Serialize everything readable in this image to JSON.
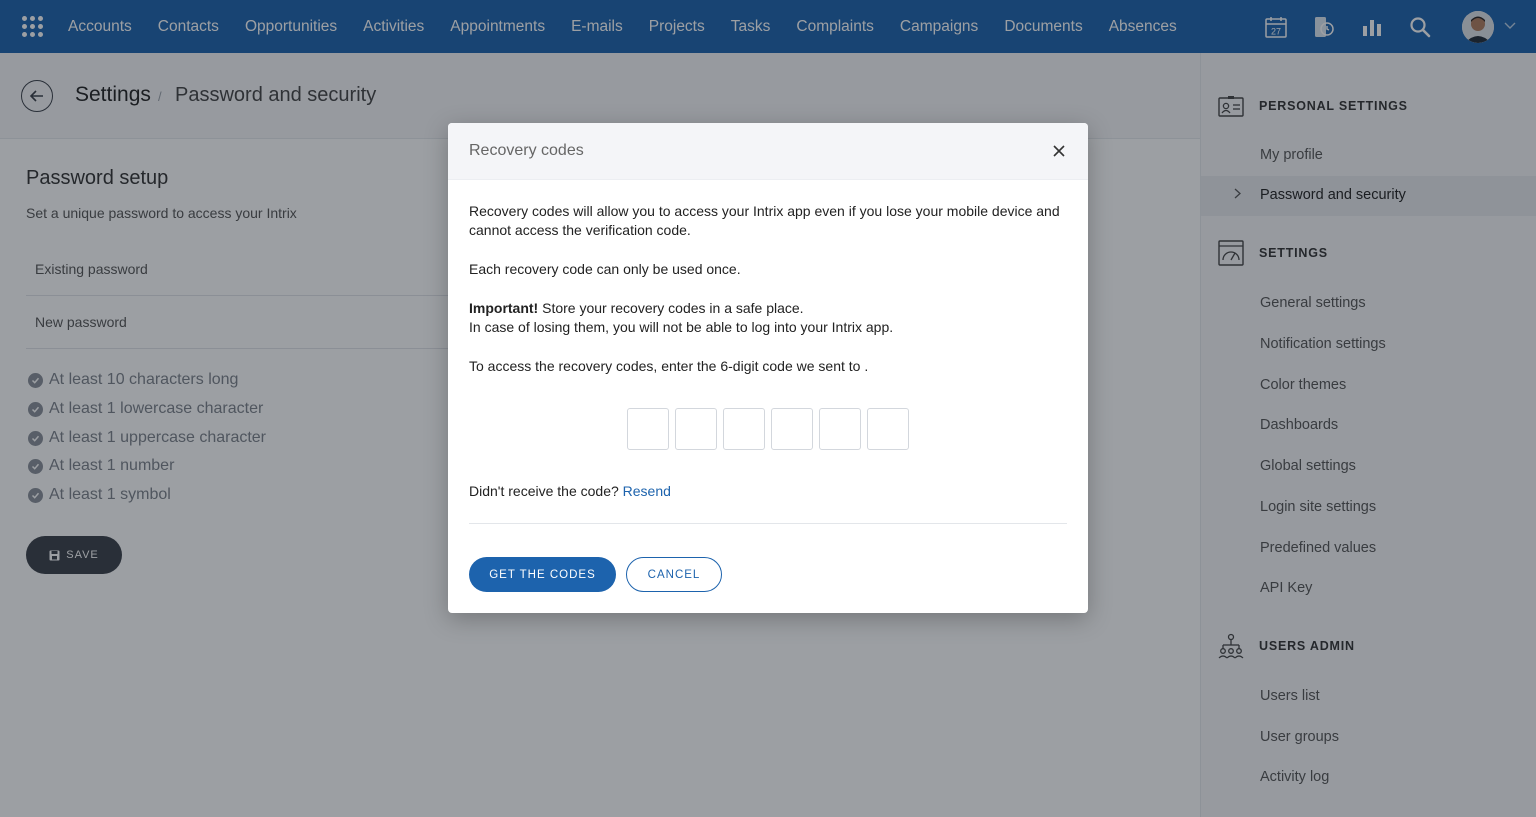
{
  "nav": {
    "items": [
      "Accounts",
      "Contacts",
      "Opportunities",
      "Activities",
      "Appointments",
      "E-mails",
      "Projects",
      "Tasks",
      "Complaints",
      "Campaigns",
      "Documents",
      "Absences"
    ],
    "calendar_day": "27",
    "icons": [
      "apps-grid-icon",
      "calendar-icon",
      "mobile-sync-icon",
      "bar-chart-icon",
      "search-icon",
      "avatar",
      "chevron-down-icon"
    ]
  },
  "breadcrumb": {
    "root": "Settings",
    "separator": "/",
    "current": "Password and security"
  },
  "password_setup": {
    "title": "Password setup",
    "subtitle": "Set a unique password to access your Intrix",
    "existing_label": "Existing password",
    "new_label": "New password",
    "rules": [
      "At least 10 characters long",
      "At least 1 lowercase character",
      "At least 1 uppercase character",
      "At least 1 number",
      "At least 1 symbol"
    ],
    "save_label": "SAVE"
  },
  "sidebar": {
    "personal": {
      "title": "PERSONAL SETTINGS",
      "items": [
        "My profile",
        "Password and security"
      ],
      "active": "Password and security"
    },
    "settings": {
      "title": "SETTINGS",
      "items": [
        "General settings",
        "Notification settings",
        "Color themes",
        "Dashboards",
        "Global settings",
        "Login site settings",
        "Predefined values",
        "API Key"
      ]
    },
    "users_admin": {
      "title": "USERS ADMIN",
      "items": [
        "Users list",
        "User groups",
        "Activity log"
      ]
    }
  },
  "modal": {
    "title": "Recovery codes",
    "p1": "Recovery codes will allow you to access your Intrix app even if you lose your mobile device and cannot access the verification code.",
    "p2": "Each recovery code can only be used once.",
    "important_bold": "Important!",
    "important_rest": " Store your recovery codes in a safe place.",
    "important_line2": "In case of losing them, you will not be able to log into your Intrix app.",
    "p4": "To access the recovery codes, enter the 6-digit code we sent to .",
    "code_length": 6,
    "resend_prompt": "Didn't receive the code?",
    "resend_link": "Resend",
    "primary_button": "GET THE CODES",
    "secondary_button": "CANCEL"
  },
  "colors": {
    "brand": "#1d63ad",
    "dark_button": "#3a3f47",
    "sidebar_bg": "#f6f7f9"
  }
}
